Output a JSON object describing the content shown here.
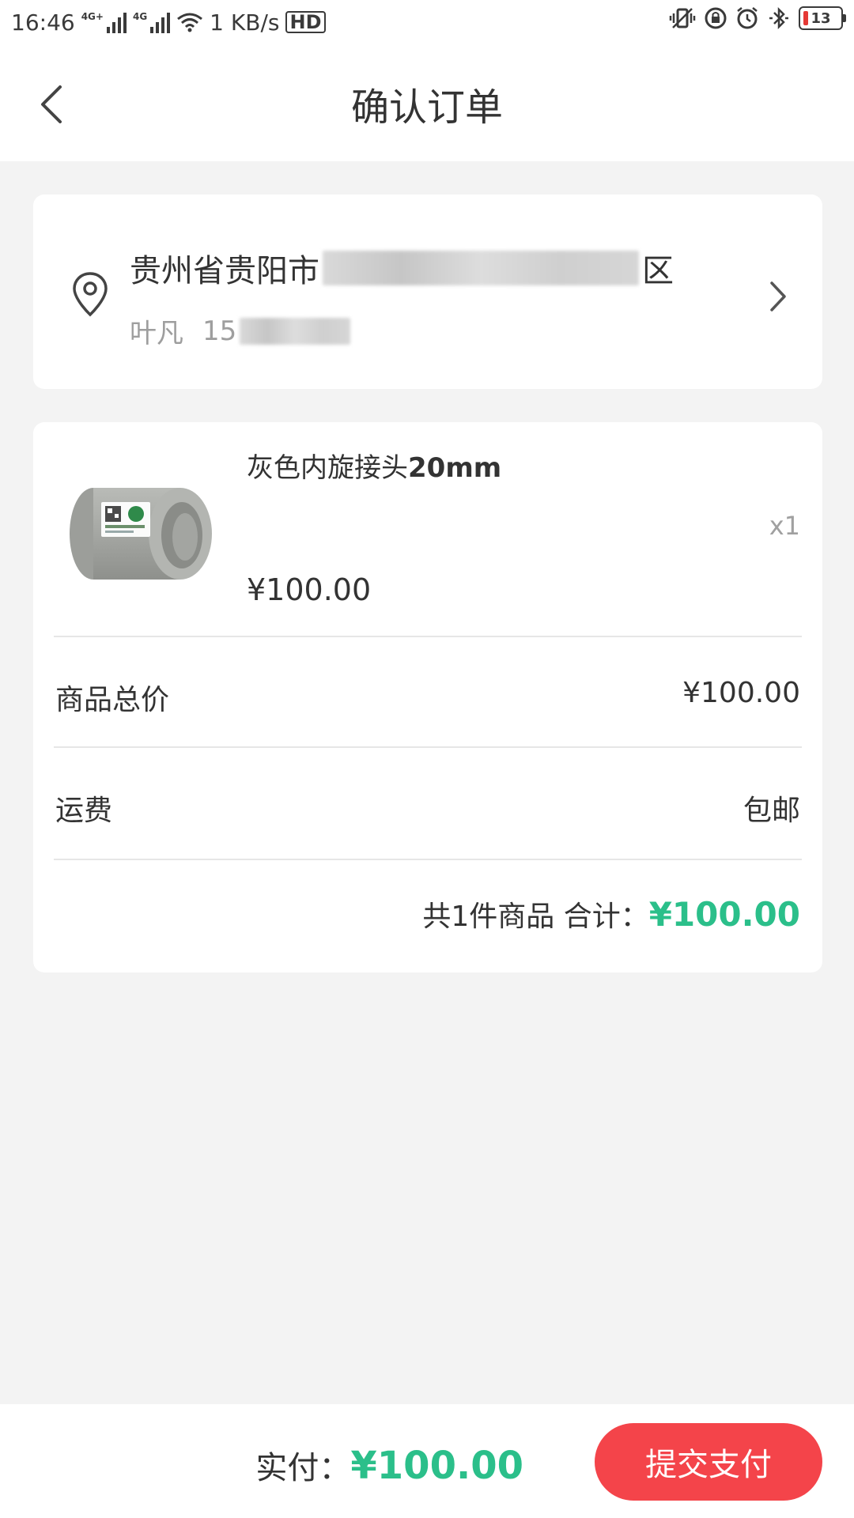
{
  "status_bar": {
    "time": "16:46",
    "network_1": "4G+",
    "network_2": "4G",
    "speed": "1 KB/s",
    "hd": "HD",
    "battery": "13",
    "icons": [
      "signal-icon",
      "wifi-icon",
      "vibrate-icon",
      "rotation-lock-icon",
      "alarm-icon",
      "bluetooth-icon",
      "battery-icon"
    ]
  },
  "header": {
    "title": "确认订单",
    "back_icon": "chevron-left-icon"
  },
  "address": {
    "line_prefix": "贵州省贵阳市",
    "line_suffix": "区",
    "name": "叶凡",
    "phone_prefix": "15",
    "icon": "location-pin-icon",
    "chevron": "chevron-right-icon"
  },
  "product": {
    "name_text": "灰色内旋接头",
    "name_size": "20mm",
    "price": "¥100.00",
    "quantity": "x1"
  },
  "rows": {
    "goods_total_label": "商品总价",
    "goods_total_value": "¥100.00",
    "shipping_label": "运费",
    "shipping_value": "包邮"
  },
  "summary": {
    "count_text": "共1件商品 合计：",
    "total": "¥100.00"
  },
  "footer": {
    "pay_label": "实付：",
    "pay_amount": "¥100.00",
    "submit_label": "提交支付"
  },
  "colors": {
    "accent_green": "#2bbf8a",
    "submit_red": "#f4444a",
    "background": "#f3f3f3"
  }
}
